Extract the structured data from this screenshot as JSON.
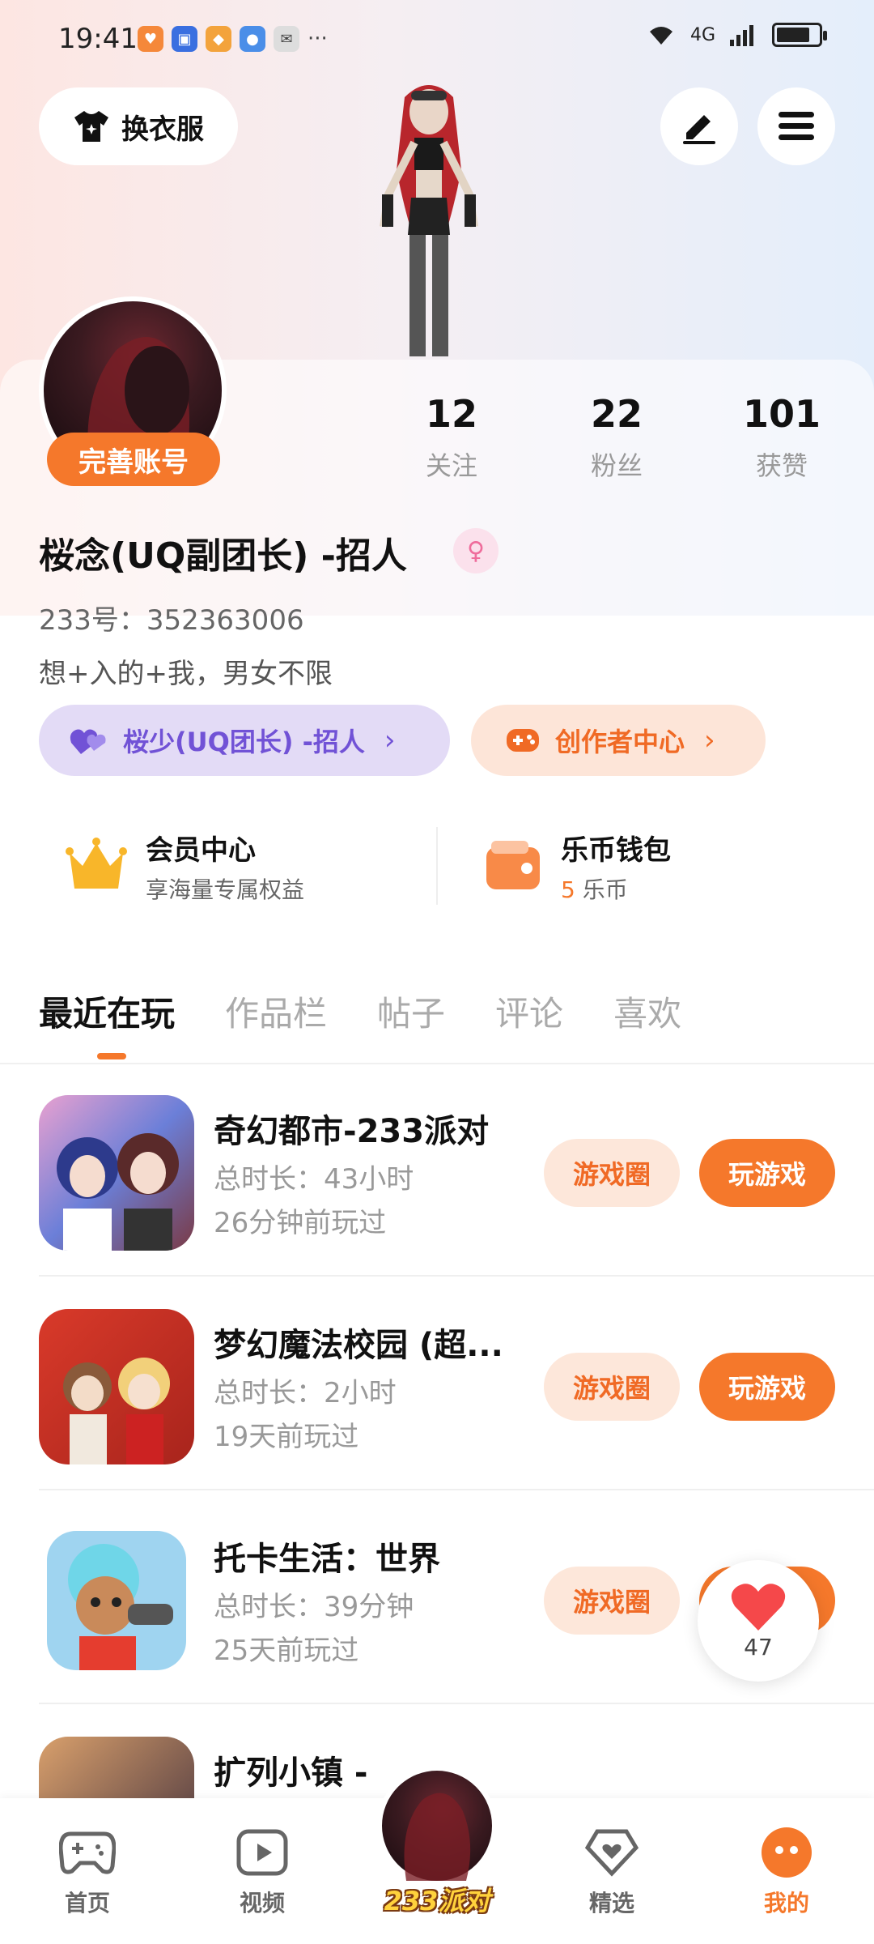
{
  "status_bar": {
    "time": "19:41",
    "network": "4G"
  },
  "header": {
    "outfit_label": "换衣服",
    "edit_icon": "pen-icon",
    "menu_icon": "menu-icon"
  },
  "profile": {
    "complete_badge": "完善账号",
    "stats": [
      {
        "num": "12",
        "label": "关注"
      },
      {
        "num": "22",
        "label": "粉丝"
      },
      {
        "num": "101",
        "label": "获赞"
      }
    ],
    "nickname": "桜念(UQ副团长) -招人",
    "uid": "233号：352363006",
    "bio": "想+入的+我，男女不限",
    "group_pill": "桜少(UQ团长) -招人",
    "creator_pill": "创作者中心",
    "vip_title": "会员中心",
    "vip_sub": "享海量专属权益",
    "wallet_title": "乐币钱包",
    "wallet_amount": "5",
    "wallet_unit": "乐币"
  },
  "tabs": [
    "最近在玩",
    "作品栏",
    "帖子",
    "评论",
    "喜欢"
  ],
  "games": [
    {
      "title": "奇幻都市-233派对",
      "duration": "总时长：43小时",
      "last_played": "26分钟前玩过",
      "circle_btn": "游戏圈",
      "play_btn": "玩游戏"
    },
    {
      "title": "梦幻魔法校园 (超...",
      "duration": "总时长：2小时",
      "last_played": "19天前玩过",
      "circle_btn": "游戏圈",
      "play_btn": "玩游戏"
    },
    {
      "title": "托卡生活：世界",
      "duration": "总时长：39分钟",
      "last_played": "25天前玩过",
      "circle_btn": "游戏圈",
      "play_btn": ""
    },
    {
      "title": "扩列小镇 -",
      "duration": "",
      "last_played": "",
      "circle_btn": "",
      "play_btn": ""
    }
  ],
  "like_float": {
    "count": "47"
  },
  "bottom_nav": [
    {
      "label": "首页",
      "icon": "gamepad-icon"
    },
    {
      "label": "视频",
      "icon": "video-play-icon"
    },
    {
      "label": "233派对",
      "icon": "avatar"
    },
    {
      "label": "精选",
      "icon": "heart-diamond-icon"
    },
    {
      "label": "我的",
      "icon": "smile-icon"
    }
  ],
  "colors": {
    "accent": "#f5782b",
    "purple": "#7152d6"
  }
}
